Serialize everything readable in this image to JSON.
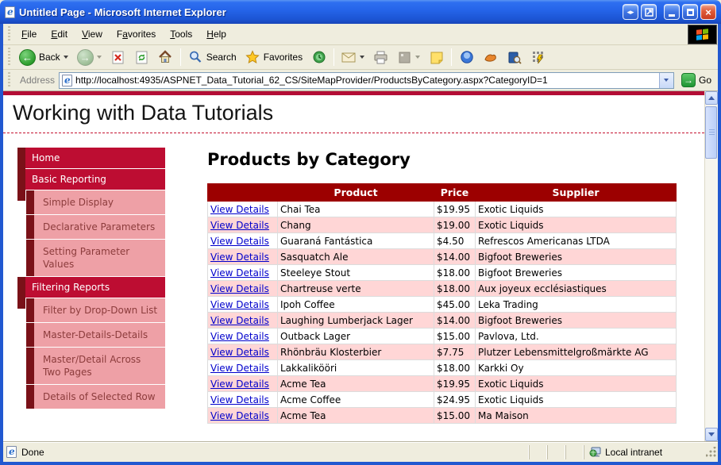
{
  "window": {
    "title": "Untitled Page - Microsoft Internet Explorer"
  },
  "menu": {
    "items": [
      {
        "label": "File",
        "accel": 0
      },
      {
        "label": "Edit",
        "accel": 0
      },
      {
        "label": "View",
        "accel": 0
      },
      {
        "label": "Favorites",
        "accel": 1
      },
      {
        "label": "Tools",
        "accel": 0
      },
      {
        "label": "Help",
        "accel": 0
      }
    ]
  },
  "toolbar": {
    "back_label": "Back",
    "search_label": "Search",
    "favorites_label": "Favorites"
  },
  "address": {
    "label": "Address",
    "url": "http://localhost:4935/ASPNET_Data_Tutorial_62_CS/SiteMapProvider/ProductsByCategory.aspx?CategoryID=1",
    "go_label": "Go"
  },
  "content": {
    "site_title": "Working with Data Tutorials",
    "page_heading": "Products by Category"
  },
  "sidebar": {
    "items": [
      {
        "label": "Home",
        "level": 1
      },
      {
        "label": "Basic Reporting",
        "level": 1
      },
      {
        "label": "Simple Display",
        "level": 2
      },
      {
        "label": "Declarative Parameters",
        "level": 2
      },
      {
        "label": "Setting Parameter Values",
        "level": 2
      },
      {
        "label": "Filtering Reports",
        "level": 1
      },
      {
        "label": "Filter by Drop-Down List",
        "level": 2
      },
      {
        "label": "Master-Details-Details",
        "level": 2
      },
      {
        "label": "Master/Detail Across Two Pages",
        "level": 2
      },
      {
        "label": "Details of Selected Row",
        "level": 2
      }
    ]
  },
  "products_table": {
    "headers": [
      "",
      "Product",
      "Price",
      "Supplier"
    ],
    "view_details_label": "View Details",
    "rows": [
      {
        "product": "Chai Tea",
        "price": "$19.95",
        "supplier": "Exotic Liquids"
      },
      {
        "product": "Chang",
        "price": "$19.00",
        "supplier": "Exotic Liquids"
      },
      {
        "product": "Guaraná Fantástica",
        "price": "$4.50",
        "supplier": "Refrescos Americanas LTDA"
      },
      {
        "product": "Sasquatch Ale",
        "price": "$14.00",
        "supplier": "Bigfoot Breweries"
      },
      {
        "product": "Steeleye Stout",
        "price": "$18.00",
        "supplier": "Bigfoot Breweries"
      },
      {
        "product": "Chartreuse verte",
        "price": "$18.00",
        "supplier": "Aux joyeux ecclésiastiques"
      },
      {
        "product": "Ipoh Coffee",
        "price": "$45.00",
        "supplier": "Leka Trading"
      },
      {
        "product": "Laughing Lumberjack Lager",
        "price": "$14.00",
        "supplier": "Bigfoot Breweries"
      },
      {
        "product": "Outback Lager",
        "price": "$15.00",
        "supplier": "Pavlova, Ltd."
      },
      {
        "product": "Rhönbräu Klosterbier",
        "price": "$7.75",
        "supplier": "Plutzer Lebensmittelgroßmärkte AG"
      },
      {
        "product": "Lakkalikööri",
        "price": "$18.00",
        "supplier": "Karkki Oy"
      },
      {
        "product": "Acme Tea",
        "price": "$19.95",
        "supplier": "Exotic Liquids"
      },
      {
        "product": "Acme Coffee",
        "price": "$24.95",
        "supplier": "Exotic Liquids"
      },
      {
        "product": "Acme Tea",
        "price": "$15.00",
        "supplier": "Ma Maison"
      }
    ]
  },
  "statusbar": {
    "status": "Done",
    "zone": "Local intranet"
  },
  "colors": {
    "titlebar_blue": "#2463E8",
    "chrome_bg": "#EFEDDE",
    "table_header_maroon": "#9C0000",
    "sidebar_crimson": "#BD0D32",
    "sidebar_dark_maroon": "#7A1118",
    "sidebar_pink": "#EEA0A6",
    "alt_row_pink": "#FFD6D6",
    "link_blue": "#0000CC",
    "rule_red": "#B30D35"
  }
}
